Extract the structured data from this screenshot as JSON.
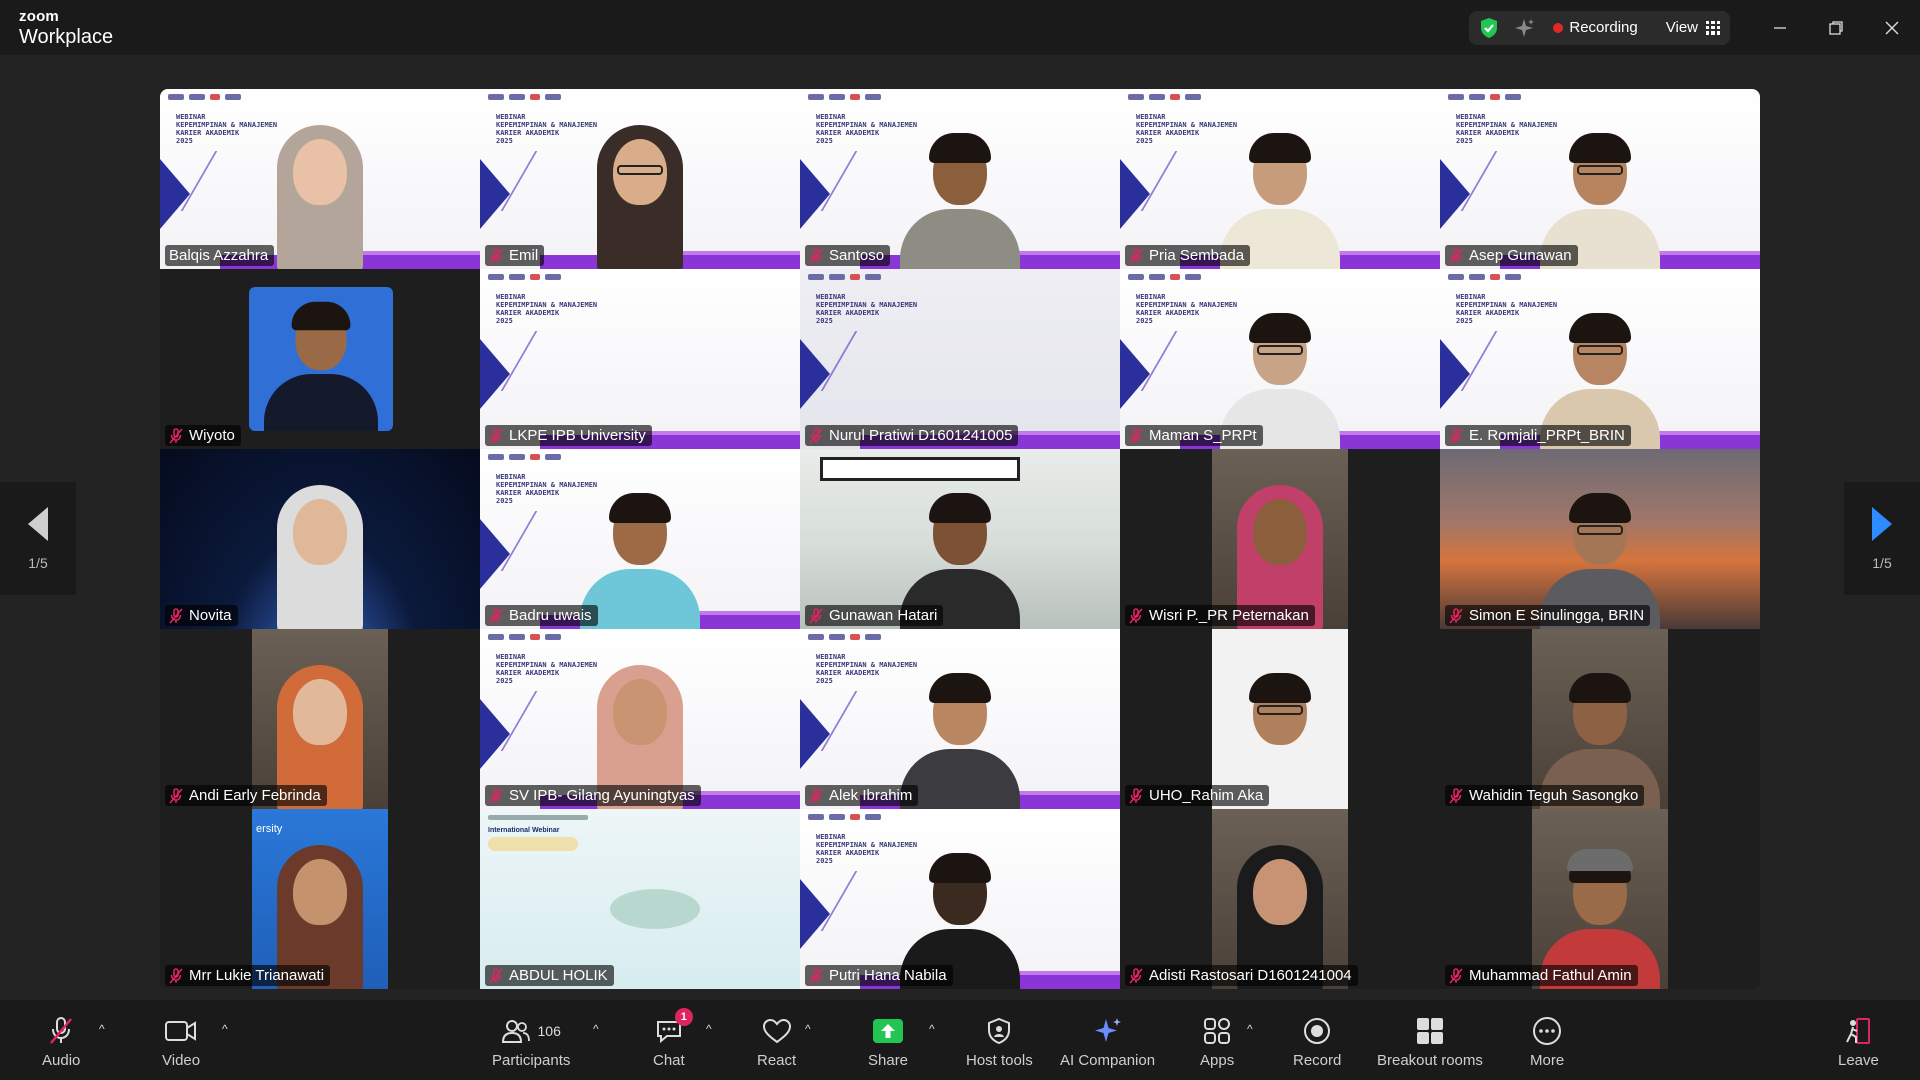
{
  "app": {
    "brand_top": "zoom",
    "brand_bottom": "Workplace"
  },
  "header": {
    "recording": "Recording",
    "view": "View"
  },
  "page_indicator": "1/5",
  "participants": [
    {
      "name": "Balqis Azzahra",
      "muted": false,
      "active": true,
      "bg": "slide",
      "person": "hijab",
      "skin": "#e8c1a6",
      "cloth": "#b3a59a"
    },
    {
      "name": "Emil",
      "muted": true,
      "bg": "slide",
      "person": "hijab-glasses",
      "skin": "#d9ad8a",
      "cloth": "#3a2d28"
    },
    {
      "name": "Santoso",
      "muted": true,
      "bg": "slide",
      "person": "man",
      "skin": "#8b5e3c",
      "cloth": "#8d8d83"
    },
    {
      "name": "Pria Sembada",
      "muted": true,
      "bg": "slide",
      "person": "man",
      "skin": "#c79c7a",
      "cloth": "#ece7d6"
    },
    {
      "name": "Asep Gunawan",
      "muted": true,
      "bg": "slide",
      "person": "man-glasses",
      "skin": "#b88460",
      "cloth": "#e8e0d0"
    },
    {
      "name": "Wiyoto",
      "muted": true,
      "bg": "dark",
      "person": "photo",
      "skin": "#9a6a46",
      "cloth": "#141a2c"
    },
    {
      "name": "LKPE IPB University",
      "muted": true,
      "bg": "slide",
      "person": "none"
    },
    {
      "name": "Nurul Pratiwi D1601241005",
      "muted": true,
      "bg": "slide-gray",
      "person": "none"
    },
    {
      "name": "Maman S_PRPt",
      "muted": true,
      "bg": "slide",
      "person": "man-glasses",
      "skin": "#c7a388",
      "cloth": "#e6e6e6"
    },
    {
      "name": "E. Romjali_PRPt_BRIN",
      "muted": true,
      "bg": "slide",
      "person": "man-glasses",
      "skin": "#b88562",
      "cloth": "#d9c8ad"
    },
    {
      "name": "Novita",
      "muted": true,
      "bg": "space",
      "person": "hijab",
      "skin": "#e0b898",
      "cloth": "#dcdcdc"
    },
    {
      "name": "Badru uwais",
      "muted": true,
      "bg": "slide",
      "person": "man",
      "skin": "#9c6a45",
      "cloth": "#6ec7d8"
    },
    {
      "name": "Gunawan Hatari",
      "muted": true,
      "bg": "room",
      "person": "man",
      "skin": "#7c5136",
      "cloth": "#2a2a2a"
    },
    {
      "name": "Wisri P._PR Peternakan",
      "muted": true,
      "bg": "dark-strip",
      "person": "hijab",
      "skin": "#8b5e3c",
      "cloth": "#c0406a"
    },
    {
      "name": "Simon E Sinulingga, BRIN",
      "muted": true,
      "bg": "sunset",
      "person": "man-glasses",
      "skin": "#a47656",
      "cloth": "#5b5b60"
    },
    {
      "name": "Andi Early Febrinda",
      "muted": true,
      "bg": "dark-strip",
      "person": "hijab",
      "skin": "#e2b89b",
      "cloth": "#d26b3a"
    },
    {
      "name": "SV IPB- Gilang Ayuningtyas",
      "muted": true,
      "bg": "slide",
      "person": "hijab",
      "skin": "#c89472",
      "cloth": "#d9a090"
    },
    {
      "name": "Alek Ibrahim",
      "muted": true,
      "bg": "slide",
      "person": "man",
      "skin": "#b88762",
      "cloth": "#3b3b40"
    },
    {
      "name": "UHO_Rahim Aka",
      "muted": true,
      "bg": "dark-strip-white",
      "person": "man-glasses",
      "skin": "#b0805c",
      "cloth": "#f2f2f2"
    },
    {
      "name": "Wahidin Teguh Sasongko",
      "muted": true,
      "bg": "dark-strip",
      "person": "man",
      "skin": "#8d6244",
      "cloth": "#7a6050"
    },
    {
      "name": "Mrr Lukie Trianawati",
      "muted": true,
      "bg": "blue-strip",
      "person": "hijab",
      "skin": "#c4936e",
      "cloth": "#6b3a2a",
      "overlay_text": "ersity"
    },
    {
      "name": "ABDUL HOLIK",
      "muted": true,
      "bg": "ocean",
      "person": "none",
      "overlay_text": "International Webinar"
    },
    {
      "name": "Putri Hana Nabila",
      "muted": true,
      "bg": "slide",
      "person": "man-dark",
      "skin": "#3b2a20",
      "cloth": "#1a1a1a"
    },
    {
      "name": "Adisti Rastosari D1601241004",
      "muted": true,
      "bg": "dark-strip",
      "person": "hijab",
      "skin": "#c89374",
      "cloth": "#1b1b1b"
    },
    {
      "name": "Muhammad Fathul Amin",
      "muted": true,
      "bg": "dark-strip",
      "person": "man-cap",
      "skin": "#9a6b49",
      "cloth": "#c33a3a"
    }
  ],
  "slide_title": "WEBINAR\nKEPEMIMPINAN & MANAJEMEN\nKARIER AKADEMIK\n2025",
  "toolbar": {
    "audio": "Audio",
    "video": "Video",
    "participants": "Participants",
    "participants_count": "106",
    "chat": "Chat",
    "chat_badge": "1",
    "react": "React",
    "share": "Share",
    "host_tools": "Host tools",
    "ai_companion": "AI Companion",
    "apps": "Apps",
    "record": "Record",
    "breakout_rooms": "Breakout rooms",
    "more": "More",
    "leave": "Leave"
  },
  "colors": {
    "accent": "#2d8cff",
    "share": "#23c552",
    "active_speaker": "#33d17a",
    "recording": "#e02828",
    "leave": "#e0245e"
  }
}
